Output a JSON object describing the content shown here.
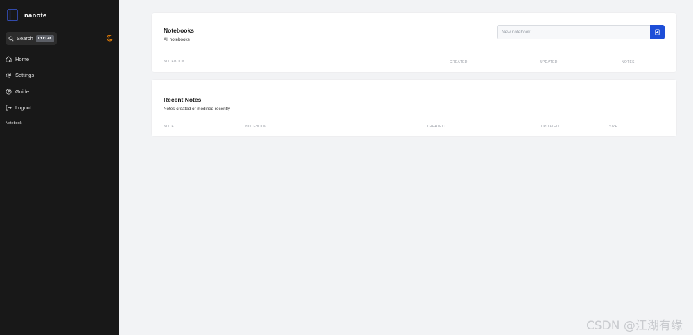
{
  "app": {
    "name": "nanote"
  },
  "sidebar": {
    "search": {
      "label": "Search",
      "shortcut": "Ctrl+K"
    },
    "items": [
      {
        "label": "Home",
        "icon": "home-icon"
      },
      {
        "label": "Settings",
        "icon": "gear-icon"
      },
      {
        "label": "Guide",
        "icon": "help-circle-icon"
      },
      {
        "label": "Logout",
        "icon": "logout-icon"
      }
    ],
    "section_label": "Notebook",
    "theme_icon": "moon-icon",
    "accent_color": "#d97706"
  },
  "notebooks": {
    "title": "Notebooks",
    "subtitle": "All notebooks",
    "input_placeholder": "New notebook",
    "columns": [
      "NOTEBOOK",
      "CREATED",
      "UPDATED",
      "NOTES"
    ],
    "rows": []
  },
  "recent": {
    "title": "Recent Notes",
    "subtitle": "Notes created or modified recently",
    "columns": [
      "NOTE",
      "NOTEBOOK",
      "CREATED",
      "UPDATED",
      "SIZE"
    ],
    "rows": []
  },
  "watermark": "CSDN @江湖有缘",
  "colors": {
    "sidebar_bg": "#181818",
    "page_bg": "#f2f3f5",
    "primary": "#1d4ed8"
  }
}
